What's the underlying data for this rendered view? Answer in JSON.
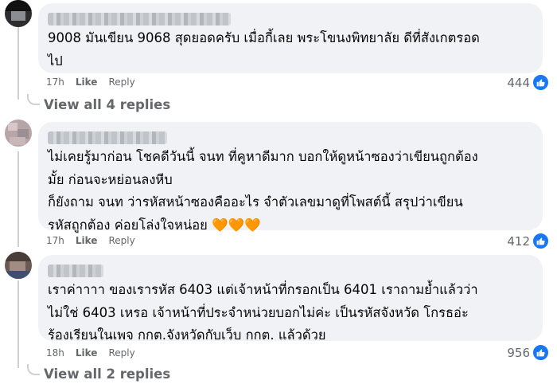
{
  "comments": [
    {
      "text": "9008 มันเขียน 9068 สุดยอดครับ เมื่อกี้เลย พระโขนงพิทยาลัย ดีที่สังเกตรอด\nไป",
      "time": "17h",
      "like_label": "Like",
      "reply_label": "Reply",
      "reactions": "444",
      "view_replies": "View all 4 replies"
    },
    {
      "text": "ไม่เคยรู้มาก่อน โชคดีวันนี้ จนท ที่คูหาดีมาก บอกให้ดูหน้าซองว่าเขียนถูกต้อง\nมั้ย ก่อนจะหย่อนลงหีบ\nก็ยังถาม จนท ว่ารหัสหน้าซองคืออะไร จำตัวเลขมาดูที่โพสต์นี้ สรุปว่าเขียน\nรหัสถูกต้อง ค่อยโล่งใจหน่อย 🧡🧡🧡",
      "time": "17h",
      "like_label": "Like",
      "reply_label": "Reply",
      "reactions": "412"
    },
    {
      "text": "เราค่าาาา ของเรารหัส 6403 แต่เจ้าหน้าที่กรอกเป็น 6401 เราถามย้ำแล้วว่า\nไม่ใช่ 6403 เหรอ เจ้าหน้าที่ประจำหน่วยบอกไม่ค่ะ เป็นรหัสจังหวัด โกรธอ่ะ\nร้องเรียนในเพจ กกต.จังหวัดกับเว็บ กกต. แล้วด้วย",
      "time": "18h",
      "like_label": "Like",
      "reply_label": "Reply",
      "reactions": "956",
      "view_replies": "View all 2 replies"
    }
  ],
  "colors": {
    "bubble": "#f0f2f5",
    "meta_text": "#65676b",
    "like_badge": "#1877f2"
  }
}
